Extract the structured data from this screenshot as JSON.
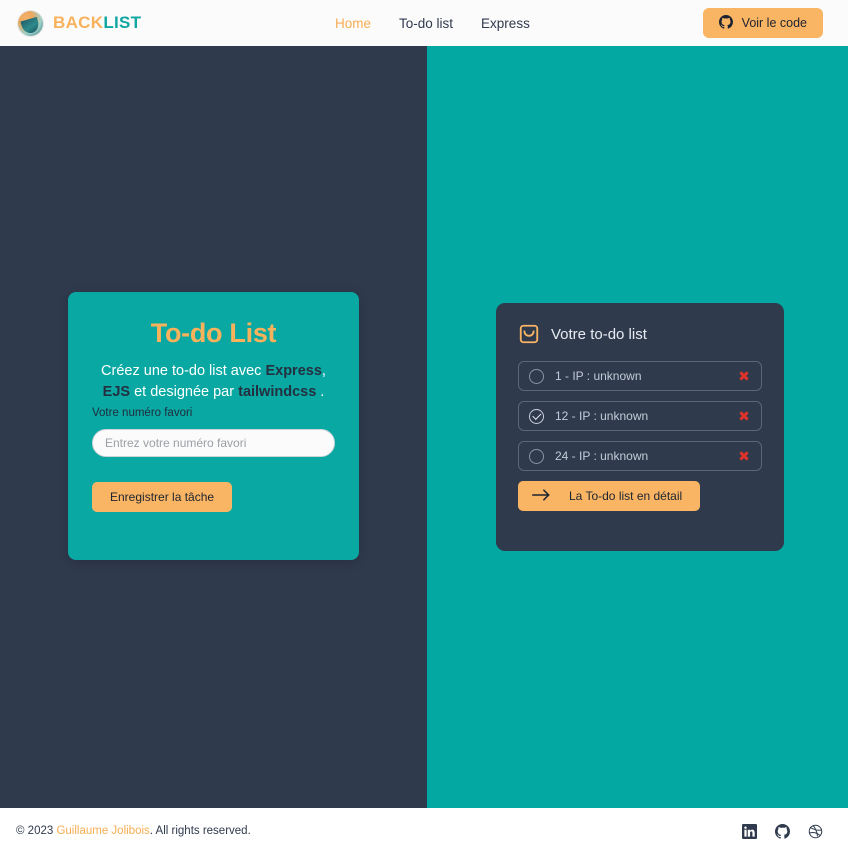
{
  "header": {
    "brand_back": "BACK",
    "brand_list": "LIST",
    "logo_icon": "backlist-circular-logo",
    "nav": [
      {
        "label": "Home",
        "active": true
      },
      {
        "label": "To-do list",
        "active": false
      },
      {
        "label": "Express",
        "active": false
      }
    ],
    "code_button": {
      "label": "Voir le code",
      "icon": "github-icon"
    }
  },
  "todo_card": {
    "title": "To-do List",
    "desc_part1": "Créez une to-do list avec ",
    "desc_bold1": "Express",
    "desc_part2": ", ",
    "desc_bold2": "EJS",
    "desc_part3": " et designée par ",
    "desc_bold3": "tailwindcss",
    "desc_part4": " .",
    "field_label": "Votre numéro favori",
    "field_placeholder": "Entrez votre numéro favori",
    "field_value": "",
    "save_label": "Enregistrer la tâche"
  },
  "list_card": {
    "icon": "inbox-icon",
    "title": "Votre to-do list",
    "items": [
      {
        "label": "1 - IP : unknown",
        "checked": false,
        "delete_icon": "close-x-icon"
      },
      {
        "label": "12 - IP : unknown",
        "checked": true,
        "delete_icon": "close-x-icon"
      },
      {
        "label": "24 - IP : unknown",
        "checked": false,
        "delete_icon": "close-x-icon"
      }
    ],
    "detail_button": {
      "label": "La To-do list en détail",
      "icon": "arrow-right-icon"
    }
  },
  "footer": {
    "copyright_prefix": "© 2023 ",
    "author": "Guillaume Jolibois",
    "copyright_suffix": ". All rights reserved.",
    "socials": [
      {
        "name": "linkedin-icon"
      },
      {
        "name": "github-icon"
      },
      {
        "name": "dribbble-icon"
      }
    ]
  },
  "colors": {
    "accent_orange": "#f9b464",
    "teal": "#04a8a3",
    "navy": "#2f3a4d",
    "danger_red": "#e0342a"
  }
}
